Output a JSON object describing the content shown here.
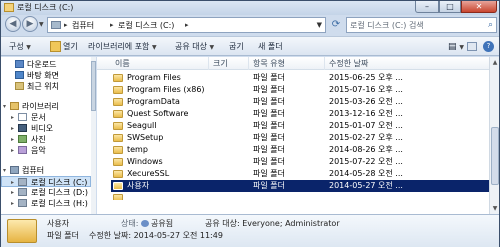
{
  "window": {
    "title": "로컬 디스크 (C:)",
    "minimize": "–",
    "maximize": "□",
    "close": "✕"
  },
  "address": {
    "crumbs": [
      "컴퓨터",
      "로컬 디스크 (C:)"
    ],
    "search_placeholder": "로컬 디스크 (C:) 검색"
  },
  "toolbar": {
    "organize": "구성",
    "open": "열기",
    "include_library": "라이브러리에 포함",
    "share_with": "공유 대상",
    "burn": "굽기",
    "new_folder": "새 폴더"
  },
  "nav": {
    "favorites": [
      {
        "label": "다운로드"
      },
      {
        "label": "바탕 화면"
      },
      {
        "label": "최근 위치"
      }
    ],
    "libraries_label": "라이브러리",
    "libraries": [
      {
        "label": "문서"
      },
      {
        "label": "비디오"
      },
      {
        "label": "사진"
      },
      {
        "label": "음악"
      }
    ],
    "computer_label": "컴퓨터",
    "drives": [
      {
        "label": "로컬 디스크 (C:)"
      },
      {
        "label": "로컬 디스크 (D:)"
      },
      {
        "label": "로컬 디스크 (H:)"
      }
    ]
  },
  "list": {
    "columns": [
      "이름",
      "크기",
      "항목 유형",
      "수정한 날짜"
    ],
    "rows": [
      {
        "name": "Program Files",
        "size": "",
        "type": "파일 폴더",
        "date": "2015-06-25 오후 ..."
      },
      {
        "name": "Program Files (x86)",
        "size": "",
        "type": "파일 폴더",
        "date": "2015-07-16 오후 ..."
      },
      {
        "name": "ProgramData",
        "size": "",
        "type": "파일 폴더",
        "date": "2015-03-26 오전 ..."
      },
      {
        "name": "Quest Software",
        "size": "",
        "type": "파일 폴더",
        "date": "2013-12-16 오전 ..."
      },
      {
        "name": "Seagull",
        "size": "",
        "type": "파일 폴더",
        "date": "2015-01-07 오전 ..."
      },
      {
        "name": "SWSetup",
        "size": "",
        "type": "파일 폴더",
        "date": "2015-02-27 오후 ..."
      },
      {
        "name": "temp",
        "size": "",
        "type": "파일 폴더",
        "date": "2014-08-26 오후 ..."
      },
      {
        "name": "Windows",
        "size": "",
        "type": "파일 폴더",
        "date": "2015-07-22 오전 ..."
      },
      {
        "name": "XecureSSL",
        "size": "",
        "type": "파일 폴더",
        "date": "2014-05-28 오전 ..."
      },
      {
        "name": "사용자",
        "size": "",
        "type": "파일 폴더",
        "date": "2014-05-27 오전 ..."
      }
    ],
    "selected_index": 9
  },
  "details": {
    "name": "사용자",
    "state_label": "상태:",
    "state_value": "공유됨",
    "shared_with": "공유 대상: Everyone; Administrator",
    "type": "파일 폴더",
    "modified": "수정한 날짜: 2014-05-27 오전 11:49"
  },
  "colors": {
    "selection": "#0a246a",
    "folder": "#e9bd4b",
    "close_button": "#c9462f"
  }
}
